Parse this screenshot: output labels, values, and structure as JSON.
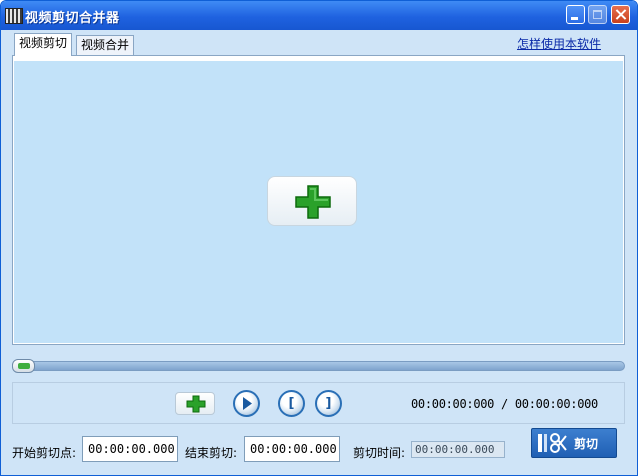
{
  "window": {
    "title": "视频剪切合并器"
  },
  "tabs": [
    {
      "label": "视频剪切",
      "active": true
    },
    {
      "label": "视频合并",
      "active": false
    }
  ],
  "help_link": "怎样使用本软件",
  "player": {
    "time_display": "00:00:00:000 / 00:00:00:000",
    "seek_position": 0
  },
  "cut": {
    "start_label": "开始剪切点:",
    "start_value": "00:00:00.000",
    "end_label": "结束剪切:",
    "end_value": "00:00:00.000",
    "duration_label": "剪切时间:",
    "duration_value": "00:00:00.000",
    "button_label": "剪切"
  },
  "icons": {
    "app": "film-icon",
    "add": "green-plus-icon",
    "play": "play-icon",
    "mark_in": "bracket-left-icon",
    "mark_out": "bracket-right-icon",
    "cut": "scissors-icon"
  },
  "colors": {
    "accent_blue": "#1f62e0",
    "plus_green": "#2aa12a",
    "video_bg": "#c2e2f9"
  }
}
